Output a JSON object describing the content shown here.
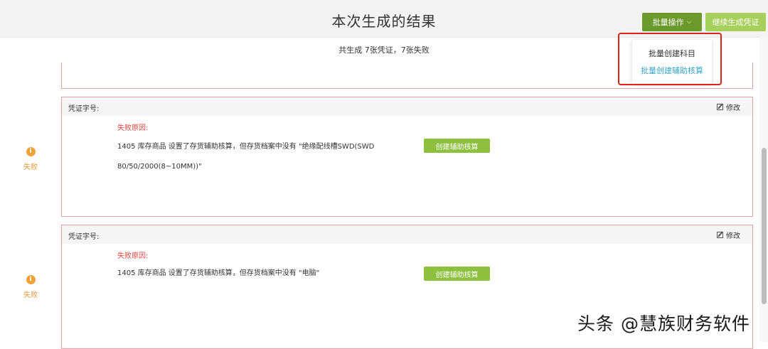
{
  "header": {
    "title": "本次生成的结果",
    "batch_button": "批量操作",
    "continue_button": "继续生成凭证"
  },
  "summary": "共生成 7张凭证，7张失败",
  "dropdown": {
    "items": [
      "批量创建科目",
      "批量创建辅助核算"
    ]
  },
  "cards": [
    {
      "label": "凭证字号:",
      "edit": "修改",
      "fail_label": "失败原因:",
      "line1": "1405 库存商品 设置了存货辅助核算，但存货档案中没有 \"绝缘配线槽SWD(SWD",
      "line2": "80/50/2000(8~10MM))\"",
      "button": "创建辅助核算",
      "status": "失败"
    },
    {
      "label": "凭证字号:",
      "edit": "修改",
      "fail_label": "失败原因:",
      "line1": "1405 库存商品 设置了存货辅助核算，但存货档案中没有 \"电脑\"",
      "line2": "",
      "button": "创建辅助核算",
      "status": "失败"
    }
  ],
  "watermark": "头条 @慧族财务软件",
  "colors": {
    "primary_green": "#6b9a2b",
    "light_green": "#a6cf5c",
    "fail_red": "#e0463f",
    "link_blue": "#3aa7c9",
    "status_orange": "#f0a23a"
  }
}
